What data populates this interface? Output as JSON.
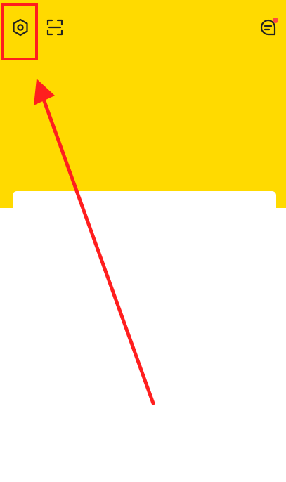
{
  "status_bar": {
    "left_text": "",
    "right_text": ""
  },
  "header": {
    "background_color": "#FFDA00",
    "settings_icon": "settings-hexagon-icon",
    "scan_icon": "scan-icon",
    "message_icon": "message-icon",
    "message_has_notification": true,
    "notification_color": "#FF4A3D"
  },
  "annotation": {
    "color": "#FF1E1E",
    "target": "settings-button"
  }
}
